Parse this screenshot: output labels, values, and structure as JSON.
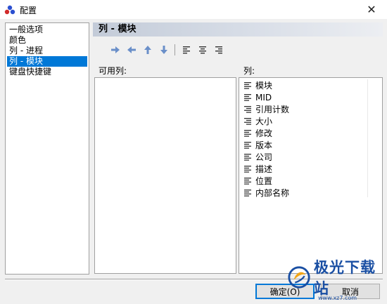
{
  "window": {
    "title": "配置",
    "close_glyph": "✕"
  },
  "nav": {
    "items": [
      {
        "label": "一般选项",
        "selected": false
      },
      {
        "label": "颜色",
        "selected": false
      },
      {
        "label": "列 - 进程",
        "selected": false
      },
      {
        "label": "列 - 模块",
        "selected": true
      },
      {
        "label": "键盘快捷键",
        "selected": false
      }
    ]
  },
  "panel": {
    "header": "列 - 模块",
    "available_label": "可用列:",
    "columns_label": "列:",
    "available_items": [],
    "columns": [
      {
        "label": "模块",
        "align": "left"
      },
      {
        "label": "MID",
        "align": "left"
      },
      {
        "label": "引用计数",
        "align": "right"
      },
      {
        "label": "大小",
        "align": "right"
      },
      {
        "label": "修改",
        "align": "left"
      },
      {
        "label": "版本",
        "align": "left"
      },
      {
        "label": "公司",
        "align": "left"
      },
      {
        "label": "描述",
        "align": "left"
      },
      {
        "label": "位置",
        "align": "left"
      },
      {
        "label": "内部名称",
        "align": "left"
      }
    ]
  },
  "toolbar": {
    "buttons": [
      "arrow-right-icon",
      "arrow-left-icon",
      "arrow-up-icon",
      "arrow-down-icon",
      "align-left-icon",
      "align-center-icon",
      "align-right-icon"
    ]
  },
  "buttons": {
    "ok": "确定(O)",
    "cancel": "取消"
  },
  "watermark": {
    "text": "极光下载站",
    "url": "www.xz7.com"
  },
  "colors": {
    "accent": "#0078d7",
    "toolbar_arrow": "#6a8fc9",
    "watermark": "#1a4fa3"
  }
}
